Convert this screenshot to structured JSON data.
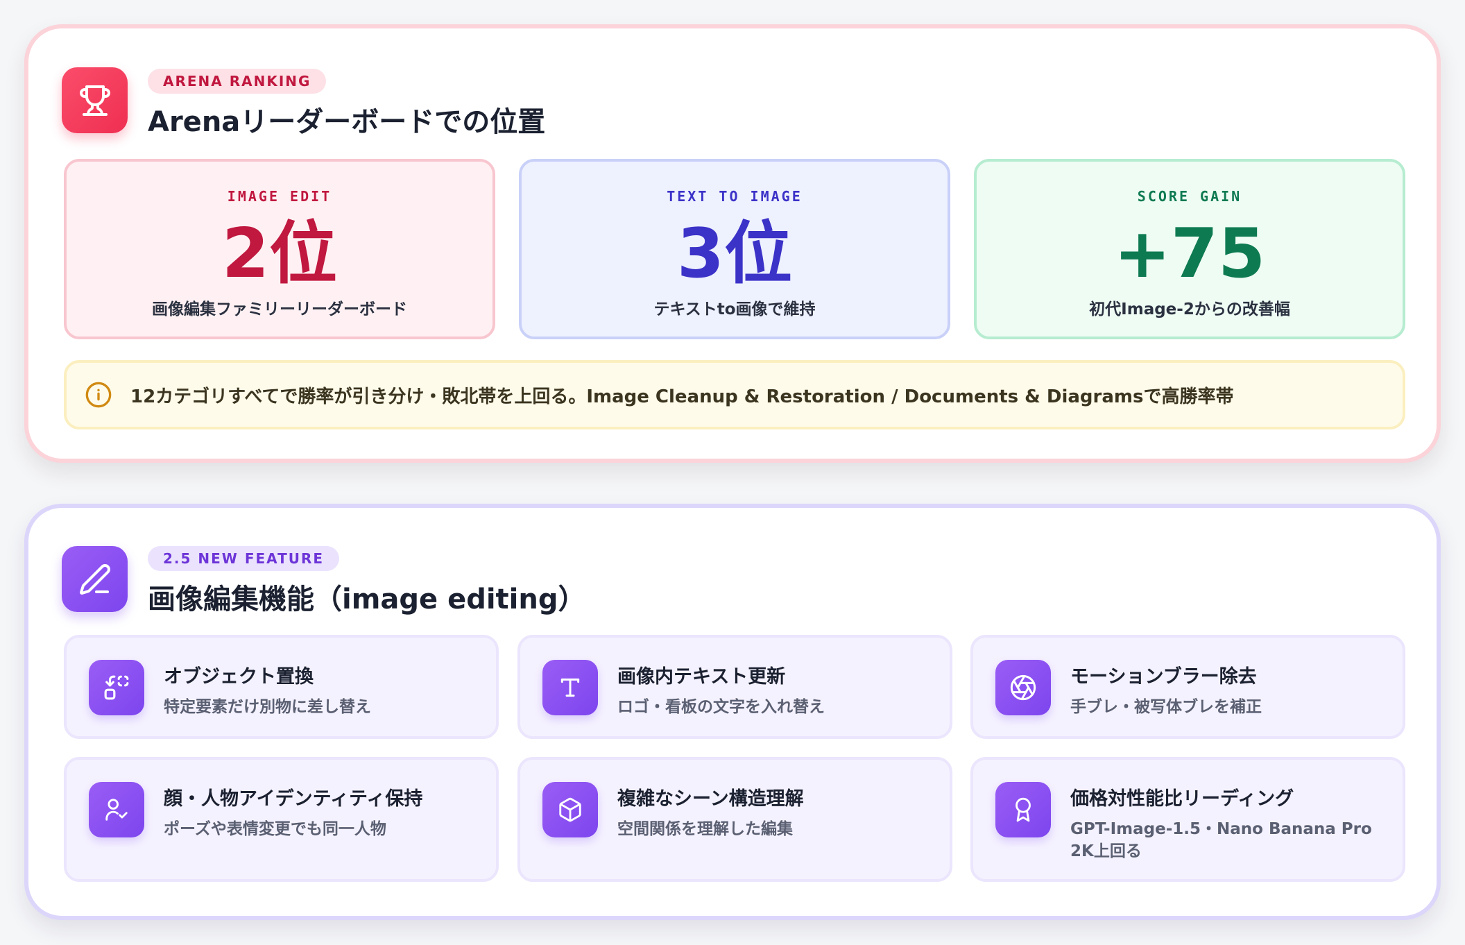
{
  "ranking": {
    "pill": "ARENA RANKING",
    "title": "Arenaリーダーボードでの位置",
    "stats": [
      {
        "label": "IMAGE EDIT",
        "value": "2位",
        "sub": "画像編集ファミリーリーダーボード"
      },
      {
        "label": "TEXT TO IMAGE",
        "value": "3位",
        "sub": "テキストto画像で維持"
      },
      {
        "label": "SCORE GAIN",
        "value": "+75",
        "sub": "初代Image-2からの改善幅"
      }
    ],
    "note": "12カテゴリすべてで勝率が引き分け・敗北帯を上回る。Image Cleanup & Restoration / Documents & Diagramsで高勝率帯"
  },
  "editing": {
    "pill": "2.5 NEW FEATURE",
    "title": "画像編集機能（image editing）",
    "features": [
      {
        "title": "オブジェクト置換",
        "sub": "特定要素だけ別物に差し替え",
        "icon": "object-replace-icon"
      },
      {
        "title": "画像内テキスト更新",
        "sub": "ロゴ・看板の文字を入れ替え",
        "icon": "text-type-icon"
      },
      {
        "title": "モーションブラー除去",
        "sub": "手ブレ・被写体ブレを補正",
        "icon": "aperture-icon"
      },
      {
        "title": "顔・人物アイデンティティ保持",
        "sub": "ポーズや表情変更でも同一人物",
        "icon": "user-check-icon"
      },
      {
        "title": "複雑なシーン構造理解",
        "sub": "空間関係を理解した編集",
        "icon": "cube-icon"
      },
      {
        "title": "価格対性能比リーディング",
        "sub": "GPT-Image-1.5・Nano Banana Pro 2K上回る",
        "icon": "award-icon"
      }
    ]
  },
  "colors": {
    "ranking_accent": "#ef2f52",
    "edit_accent": "#c0183f",
    "t2i_accent": "#3b32c8",
    "gain_accent": "#0e7a52",
    "feature_accent": "#7d45ee"
  }
}
